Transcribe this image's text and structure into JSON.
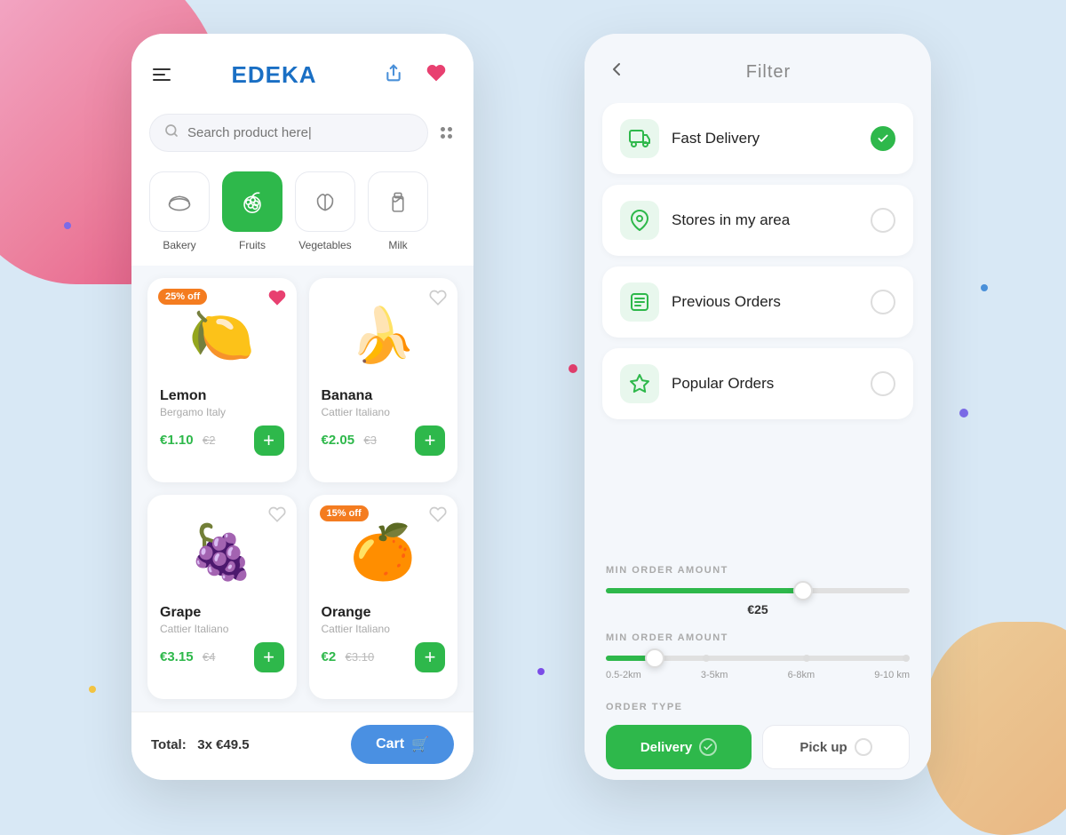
{
  "background": {
    "color": "#d8e8f5"
  },
  "left_phone": {
    "header": {
      "logo": "EDEKA",
      "share_icon": "↗",
      "heart_icon": "♥"
    },
    "search": {
      "placeholder": "Search product here|",
      "filter_icon": "filter"
    },
    "categories": [
      {
        "id": "bakery",
        "label": "Bakery",
        "icon": "🥖",
        "active": false
      },
      {
        "id": "fruits",
        "label": "Fruits",
        "icon": "🍇",
        "active": true
      },
      {
        "id": "vegetables",
        "label": "Vegetables",
        "icon": "🥦",
        "active": false
      },
      {
        "id": "milk",
        "label": "Milk",
        "icon": "🥛",
        "active": false
      }
    ],
    "products": [
      {
        "id": "lemon",
        "name": "Lemon",
        "origin": "Bergamo Italy",
        "price": "€1.10",
        "old_price": "€2",
        "discount": "25% off",
        "emoji": "🍋",
        "favorited": true,
        "fav_color": "#e84070"
      },
      {
        "id": "banana",
        "name": "Banana",
        "origin": "Cattier Italiano",
        "price": "€2.05",
        "old_price": "€3",
        "discount": null,
        "emoji": "🍌",
        "favorited": false,
        "fav_color": "#ccc"
      },
      {
        "id": "grape",
        "name": "Grape",
        "origin": "Cattier Italiano",
        "price": "€3.15",
        "old_price": "€4",
        "discount": null,
        "emoji": "🍇",
        "favorited": false,
        "fav_color": "#ccc"
      },
      {
        "id": "orange",
        "name": "Orange",
        "origin": "Cattier Italiano",
        "price": "€2",
        "old_price": "€3.10",
        "discount": "15% off",
        "emoji": "🍊",
        "favorited": false,
        "fav_color": "#ccc"
      }
    ],
    "cart": {
      "total_label": "Total:",
      "quantity": "3x",
      "amount": "€49.5",
      "cart_label": "Cart",
      "cart_icon": "🛒"
    }
  },
  "right_phone": {
    "header": {
      "back_icon": "‹",
      "title": "Filter"
    },
    "filter_options": [
      {
        "id": "fast-delivery",
        "label": "Fast Delivery",
        "icon": "🚚",
        "checked": true
      },
      {
        "id": "stores-in-area",
        "label": "Stores in my area",
        "icon": "📍",
        "checked": false
      },
      {
        "id": "previous-orders",
        "label": "Previous Orders",
        "icon": "🧾",
        "checked": false
      },
      {
        "id": "popular-orders",
        "label": "Popular Orders",
        "icon": "⭐",
        "checked": false
      }
    ],
    "min_order": {
      "label": "MIN ORDER AMOUNT",
      "value": "€25",
      "fill_percent": 65
    },
    "distance": {
      "label": "MIN ORDER AMOUNT",
      "thumb_percent": 16,
      "labels": [
        "0.5-2km",
        "3-5km",
        "6-8km",
        "9-10 km"
      ]
    },
    "order_type": {
      "label": "ORDER TYPE",
      "options": [
        {
          "id": "delivery",
          "label": "Delivery",
          "active": true
        },
        {
          "id": "pickup",
          "label": "Pick up",
          "active": false
        }
      ]
    }
  }
}
